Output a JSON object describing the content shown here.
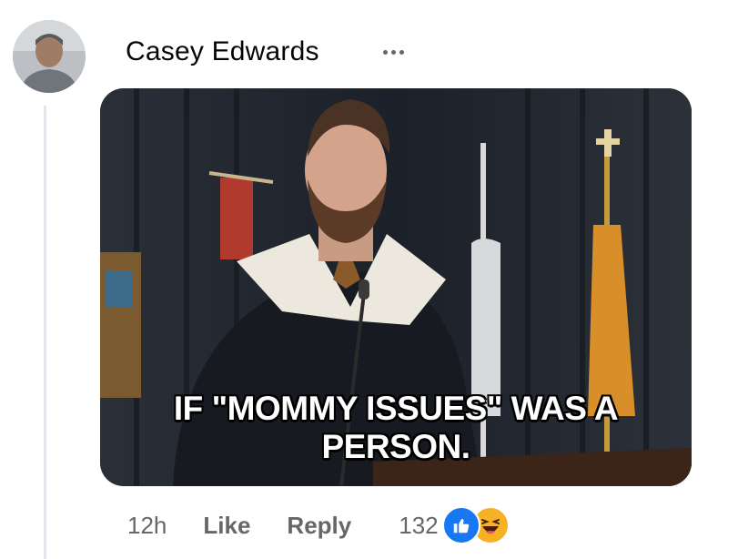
{
  "comment": {
    "author": "Casey Edwards",
    "more_icon": "more-horizontal-icon",
    "image": {
      "caption": "IF \"MOMMY ISSUES\" WAS A PERSON."
    },
    "actions": {
      "time": "12h",
      "like_label": "Like",
      "reply_label": "Reply",
      "reaction_count": "132",
      "reactions": [
        "like-reaction-icon",
        "haha-reaction-icon"
      ]
    }
  },
  "colors": {
    "text_primary": "#050505",
    "text_secondary": "#65676b",
    "like_blue": "#1877f2",
    "haha_yellow": "#f7b125",
    "thread_line": "#e4e6eb"
  }
}
